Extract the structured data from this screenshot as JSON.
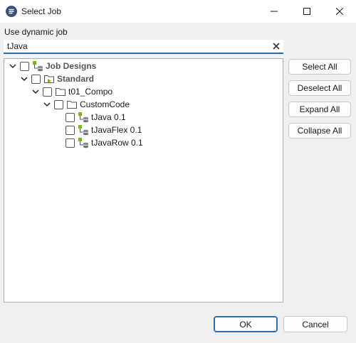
{
  "window": {
    "title": "Select Job",
    "icon": "talend-app-icon",
    "controls": [
      "minimize-icon",
      "maximize-icon",
      "close-icon"
    ]
  },
  "dialog": {
    "dynamic_label": "Use dynamic job",
    "filter_value": "tJava",
    "clear_icon": "clear-icon"
  },
  "tree": {
    "nodes": [
      {
        "label": "Job Designs",
        "expanded": true,
        "bold": true,
        "icon": "job-designs-icon"
      },
      {
        "label": "Standard",
        "expanded": true,
        "bold": true,
        "icon": "standard-folder-icon"
      },
      {
        "label": "t01_Compo",
        "expanded": true,
        "icon": "folder-icon"
      },
      {
        "label": "CustomCode",
        "expanded": true,
        "icon": "folder-icon"
      },
      {
        "label": "tJava 0.1",
        "icon": "job-icon"
      },
      {
        "label": "tJavaFlex 0.1",
        "icon": "job-icon"
      },
      {
        "label": "tJavaRow 0.1",
        "icon": "job-icon"
      }
    ]
  },
  "side_buttons": {
    "select_all": "Select All",
    "deselect_all": "Deselect All",
    "expand_all": "Expand All",
    "collapse_all": "Collapse All"
  },
  "footer": {
    "ok": "OK",
    "cancel": "Cancel"
  },
  "colors": {
    "accent": "#2b6cb0",
    "job_green": "#7cb518",
    "db_gray": "#7a7a7a"
  }
}
